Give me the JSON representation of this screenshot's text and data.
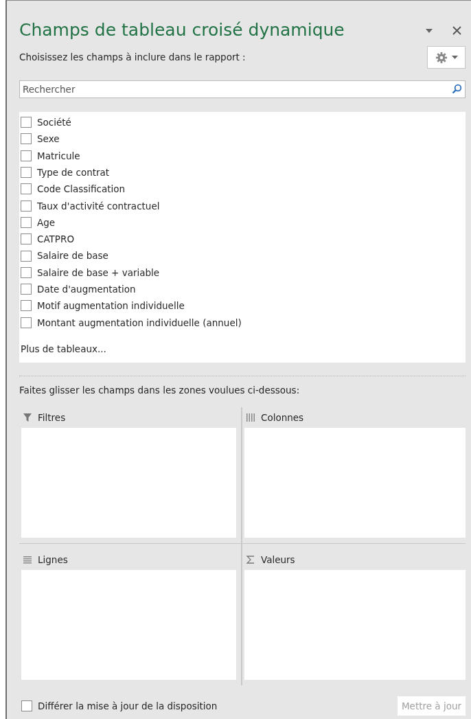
{
  "pane": {
    "title": "Champs de tableau croisé dynamique"
  },
  "instruction": "Choisissez les champs à inclure dans le rapport :",
  "search": {
    "placeholder": "Rechercher"
  },
  "fields": [
    {
      "label": "Société",
      "checked": false
    },
    {
      "label": "Sexe",
      "checked": false
    },
    {
      "label": "Matricule",
      "checked": false
    },
    {
      "label": "Type de contrat",
      "checked": false
    },
    {
      "label": "Code Classification",
      "checked": false
    },
    {
      "label": "Taux d'activité contractuel",
      "checked": false
    },
    {
      "label": "Age",
      "checked": false
    },
    {
      "label": "CATPRO",
      "checked": false
    },
    {
      "label": "Salaire de base",
      "checked": false
    },
    {
      "label": "Salaire de base + variable",
      "checked": false
    },
    {
      "label": "Date d'augmentation",
      "checked": false
    },
    {
      "label": "Motif augmentation individuelle",
      "checked": false
    },
    {
      "label": "Montant augmentation individuelle (annuel)",
      "checked": false
    }
  ],
  "more_tables": "Plus de tableaux...",
  "drag_hint": "Faites glisser les champs dans les zones voulues ci-dessous:",
  "zones": [
    {
      "kind": "filter",
      "label": "Filtres"
    },
    {
      "kind": "columns",
      "label": "Colonnes"
    },
    {
      "kind": "rows",
      "label": "Lignes"
    },
    {
      "kind": "values",
      "label": "Valeurs"
    }
  ],
  "defer": {
    "label": "Différer la mise à jour de la disposition",
    "checked": false
  },
  "update_button": {
    "label": "Mettre à jour",
    "disabled": true
  }
}
